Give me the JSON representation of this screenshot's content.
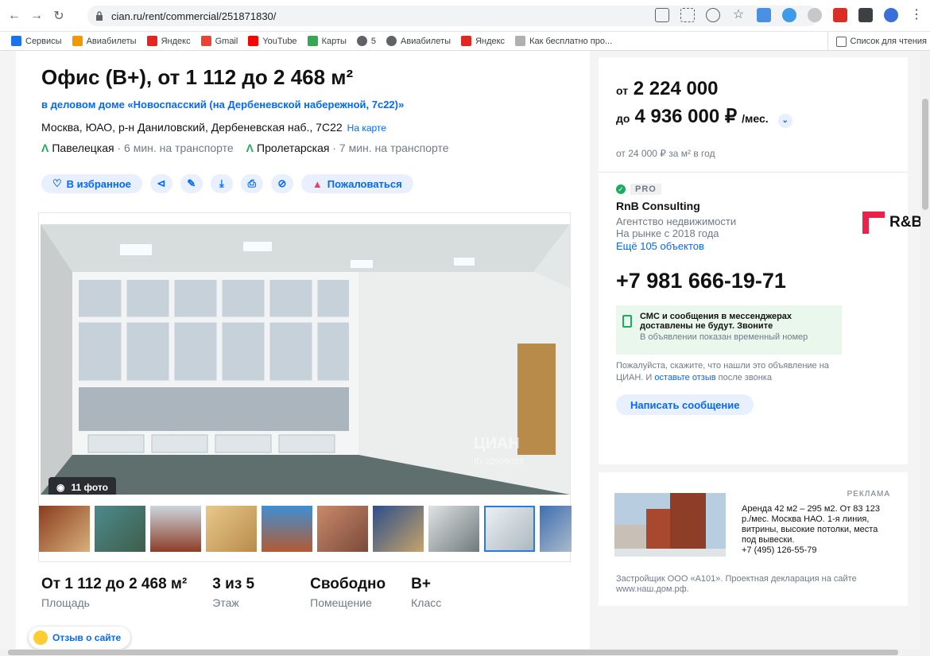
{
  "browser": {
    "url": "cian.ru/rent/commercial/251871830/",
    "bookmarks": [
      "Сервисы",
      "Авиабилеты",
      "Яндекс",
      "Gmail",
      "YouTube",
      "Карты",
      "5",
      "Авиабилеты",
      "Яндекс",
      "Как бесплатно про..."
    ],
    "reading_list": "Список для чтения"
  },
  "listing": {
    "title": "Офис (B+), от 1 112 до 2 468 м²",
    "building_link": "в деловом доме «Новоспасский (на Дербеневской набережной, 7с22)»",
    "address": "Москва, ЮАО, р-н Даниловский, Дербеневская наб., 7С22",
    "map_link": "На карте",
    "metro": [
      {
        "station": "Павелецкая",
        "time": "· 6 мин. на транспорте"
      },
      {
        "station": "Пролетарская",
        "time": "· 7 мин. на транспорте"
      }
    ],
    "actions": {
      "favorite": "В избранное",
      "complain": "Пожаловаться"
    },
    "photo_count": "11 фото",
    "watermark": "ЦИАН",
    "watermark_id": "ID 22909093",
    "specs": [
      {
        "value": "От 1 112 до 2 468 м²",
        "label": "Площадь"
      },
      {
        "value": "3 из 5",
        "label": "Этаж"
      },
      {
        "value": "Свободно",
        "label": "Помещение"
      },
      {
        "value": "B+",
        "label": "Класс"
      }
    ],
    "feedback_button": "Отзыв о сайте"
  },
  "price": {
    "from_prefix": "от",
    "from": "2 224 000",
    "to_prefix": "до",
    "to": "4 936 000 ₽",
    "per": "/мес.",
    "per_m2": "от 24 000 ₽ за м² в год"
  },
  "agent": {
    "badge": "PRO",
    "name": "RnB Consulting",
    "type": "Агентство недвижимости",
    "since": "На рынке с 2018 года",
    "more": "Ещё 105 объектов",
    "logo": "R&B",
    "phone": "+7 981 666-19-71",
    "notice_title": "СМС и сообщения в мессенджерах доставлены не будут. Звоните",
    "notice_sub": "В объявлении показан временный номер",
    "ask_text": "Пожалуйста, скажите, что нашли это объявление на ЦИАН. И",
    "ask_link": "оставьте отзыв",
    "ask_end": "после звонка",
    "message_button": "Написать сообщение"
  },
  "ad": {
    "label": "РЕКЛАМА",
    "text": "Аренда 42 м2 – 295 м2. От 83 123 р./мес. Москва НАО. 1-я линия, витрины, высокие потолки, места под вывески.",
    "phone": "+7 (495) 126-55-79",
    "developer": "Застройщик ООО «А101». Проектная декларация на сайте www.наш.дом.рф."
  },
  "colors": {
    "accent": "#0468ff",
    "metro_green": "#1aad5f",
    "logo_red": "#e8234a"
  }
}
